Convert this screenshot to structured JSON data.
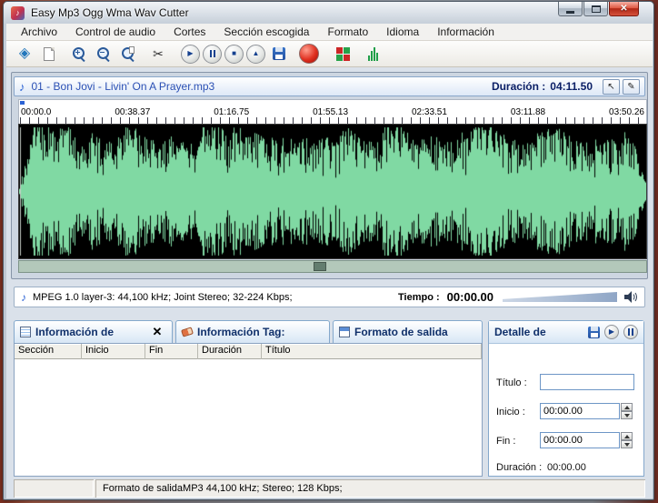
{
  "window": {
    "title": "Easy Mp3 Ogg Wma Wav Cutter"
  },
  "icons": {
    "open": "◈",
    "scissors": "✂",
    "play": "▶",
    "stop": "■",
    "eject": "▲",
    "record": "●",
    "note": "♪",
    "cursor": "↖",
    "pencil": "✎",
    "close": "✕",
    "tab_close": "✕",
    "detail_play": "▶"
  },
  "menu": {
    "items": [
      "Archivo",
      "Control de audio",
      "Cortes",
      "Sección escogida",
      "Formato",
      "Idioma",
      "Información"
    ]
  },
  "player": {
    "track_title": "01 - Bon Jovi - Livin' On A Prayer.mp3",
    "duration_label": "Duración :",
    "duration_value": "04:11.50"
  },
  "timeline": {
    "ticks": [
      "00:00.0",
      "00:38.37",
      "01:16.75",
      "01:55.13",
      "02:33.51",
      "03:11.88",
      "03:50.26"
    ]
  },
  "status": {
    "format_info": "MPEG 1.0 layer-3: 44,100 kHz; Joint Stereo; 32-224 Kbps;",
    "time_label": "Tiempo :",
    "time_value": "00:00.00"
  },
  "tabs": {
    "sections_label": "Información de",
    "tag_label": "Información Tag:",
    "format_label": "Formato de salida"
  },
  "table": {
    "headers": [
      "Sección",
      "Inicio",
      "Fin",
      "Duración",
      "Título"
    ],
    "rows": []
  },
  "detail": {
    "title": "Detalle de",
    "titulo_label": "Título :",
    "titulo_value": "",
    "inicio_label": "Inicio :",
    "inicio_value": "00:00.00",
    "fin_label": "Fin :",
    "fin_value": "00:00.00",
    "duracion_label": "Duración :",
    "duracion_value": "00:00.00"
  },
  "footer": {
    "text": "Formato de salidaMP3 44,100 kHz; Stereo;  128 Kbps;"
  },
  "waveform": {
    "background": "#000000",
    "color": "#80d9a3",
    "cursor_color": "#c8d0c8",
    "seed": 23
  }
}
